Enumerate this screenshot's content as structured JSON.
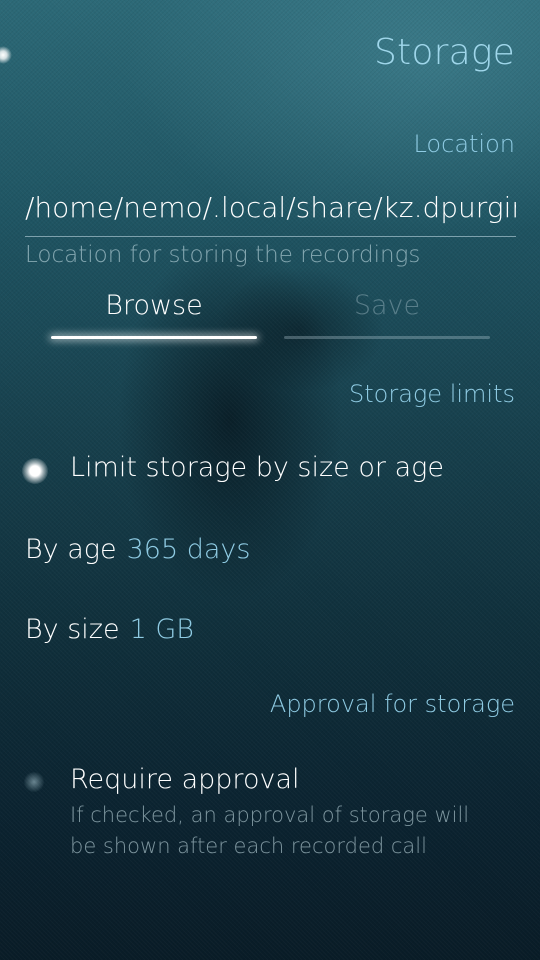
{
  "page": {
    "title": "Storage"
  },
  "location_section": {
    "header": "Location",
    "path_value": "/home/nemo/.local/share/kz.dpurgin/",
    "path_description": "Location for storing the recordings",
    "browse_label": "Browse",
    "save_label": "Save"
  },
  "limits_section": {
    "header": "Storage limits",
    "limit_switch_label": "Limit storage by size or age",
    "limit_switch_checked": true,
    "by_age_label": "By age",
    "by_age_value": "365 days",
    "by_size_label": "By size",
    "by_size_value": "1 GB"
  },
  "approval_section": {
    "header": "Approval for storage",
    "approval_switch_label": "Require approval",
    "approval_switch_checked": false,
    "approval_description": "If checked, an approval of storage will be shown after each recorded call"
  },
  "colors": {
    "highlight": "#8fcbe3",
    "background_top": "#2c6977",
    "background_bottom": "#091c27"
  }
}
